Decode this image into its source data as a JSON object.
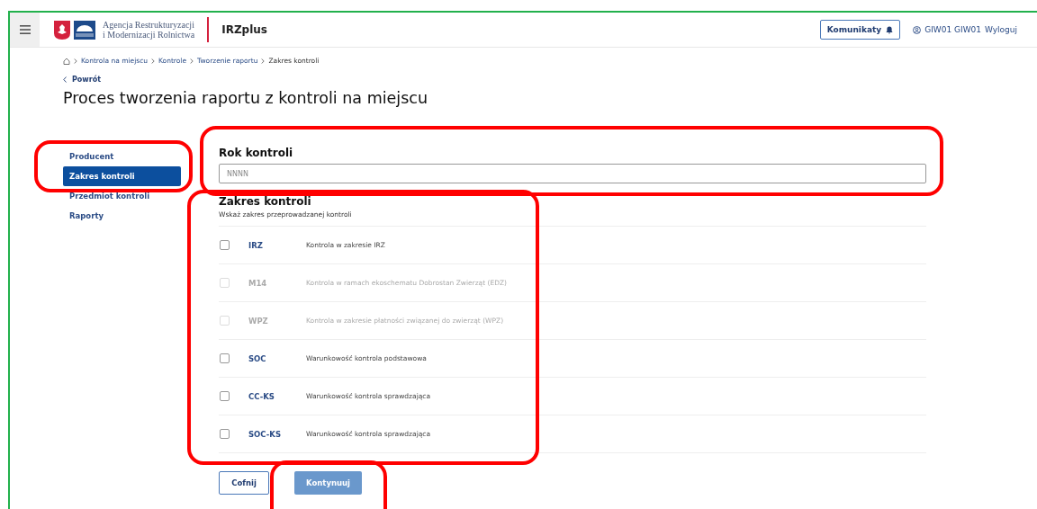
{
  "header": {
    "agency_line1": "Agencja Restrukturyzacji",
    "agency_line2": "i Modernizacji Rolnictwa",
    "app_title": "IRZplus",
    "messages_button": "Komunikaty",
    "user": "GIW01 GIW01",
    "logout": "Wyloguj"
  },
  "breadcrumb": [
    "Kontrola na miejscu",
    "Kontrole",
    "Tworzenie raportu",
    "Zakres kontroli"
  ],
  "back_link": "Powrót",
  "title": "Proces tworzenia raportu z kontroli na miejscu",
  "sidebar": {
    "items": [
      {
        "label": "Producent",
        "selected": false
      },
      {
        "label": "Zakres kontroli",
        "selected": true
      },
      {
        "label": "Przedmiot kontroli",
        "selected": false
      },
      {
        "label": "Raporty",
        "selected": false
      }
    ]
  },
  "year_field": {
    "label": "Rok kontroli",
    "placeholder": "NNNN"
  },
  "scope": {
    "heading": "Zakres kontroli",
    "hint": "Wskaż zakres przeprowadzanej kontroli",
    "rows": [
      {
        "code": "IRZ",
        "description": "Kontrola w zakresie IRZ",
        "checked": false,
        "disabled": false
      },
      {
        "code": "M14",
        "description": "Kontrola w ramach ekoschematu Dobrostan Zwierząt (EDZ)",
        "checked": false,
        "disabled": true
      },
      {
        "code": "WPZ",
        "description": "Kontrola w zakresie płatności związanej do zwierząt (WPZ)",
        "checked": false,
        "disabled": true
      },
      {
        "code": "SOC",
        "description": "Warunkowość kontrola podstawowa",
        "checked": false,
        "disabled": false
      },
      {
        "code": "CC-KS",
        "description": "Warunkowość kontrola sprawdzająca",
        "checked": false,
        "disabled": false
      },
      {
        "code": "SOC-KS",
        "description": "Warunkowość kontrola sprawdzająca",
        "checked": false,
        "disabled": false
      }
    ]
  },
  "buttons": {
    "back": "Cofnij",
    "continue": "Kontynuuj",
    "continue_disabled": true
  },
  "highlights": [
    {
      "kind": "sidebar"
    },
    {
      "kind": "year"
    },
    {
      "kind": "scope"
    },
    {
      "kind": "continue"
    }
  ]
}
